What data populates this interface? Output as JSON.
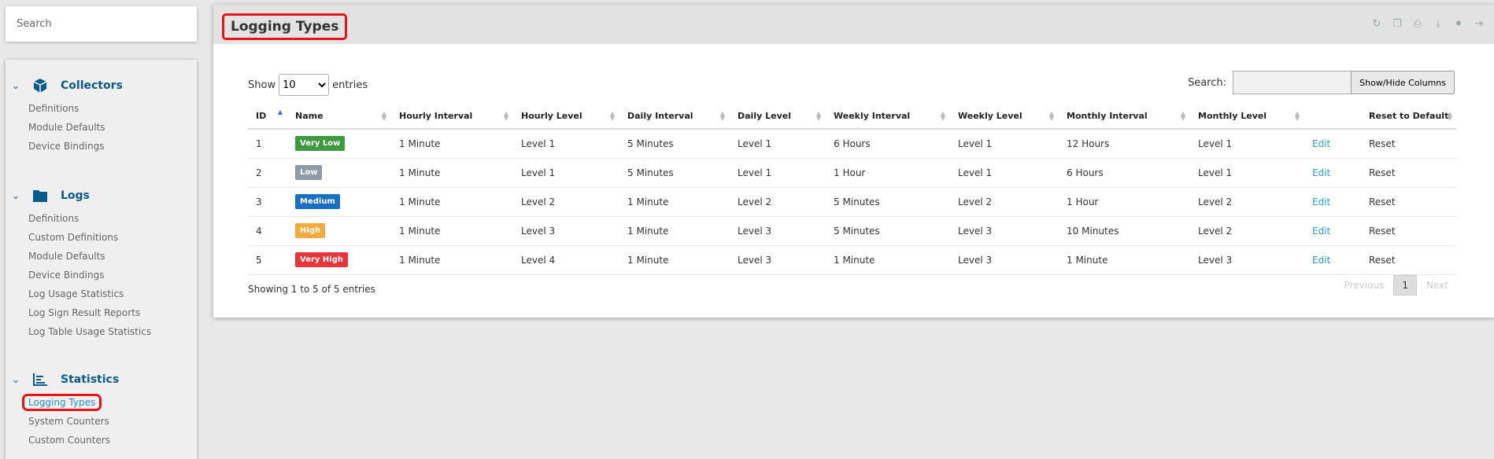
{
  "sidebar": {
    "search_placeholder": "Search",
    "sections": [
      {
        "title": "Collectors",
        "icon": "cube-icon",
        "items": [
          "Definitions",
          "Module Defaults",
          "Device Bindings"
        ]
      },
      {
        "title": "Logs",
        "icon": "folder-icon",
        "items": [
          "Definitions",
          "Custom Definitions",
          "Module Defaults",
          "Device Bindings",
          "Log Usage Statistics",
          "Log Sign Result Reports",
          "Log Table Usage Statistics"
        ]
      },
      {
        "title": "Statistics",
        "icon": "chart-icon",
        "items": [
          "Logging Types",
          "System Counters",
          "Custom Counters"
        ]
      }
    ],
    "active_item": "Logging Types"
  },
  "panel": {
    "title": "Logging Types",
    "show_label": "Show",
    "entries_label": "entries",
    "page_length": "10",
    "search_label": "Search:",
    "showhide_label": "Show/Hide Columns",
    "columns": [
      "ID",
      "Name",
      "Hourly Interval",
      "Hourly Level",
      "Daily Interval",
      "Daily Level",
      "Weekly Interval",
      "Weekly Level",
      "Monthly Interval",
      "Monthly Level",
      "",
      "Reset to Default"
    ],
    "rows": [
      {
        "id": "1",
        "name": "Very Low",
        "color": "#3f9a3f",
        "hi": "1 Minute",
        "hl": "Level 1",
        "di": "5 Minutes",
        "dl": "Level 1",
        "wi": "6 Hours",
        "wl": "Level 1",
        "mi": "12 Hours",
        "ml": "Level 1",
        "edit": "Edit",
        "reset": "Reset"
      },
      {
        "id": "2",
        "name": "Low",
        "color": "#8e9aa6",
        "hi": "1 Minute",
        "hl": "Level 1",
        "di": "5 Minutes",
        "dl": "Level 1",
        "wi": "1 Hour",
        "wl": "Level 1",
        "mi": "6 Hours",
        "ml": "Level 1",
        "edit": "Edit",
        "reset": "Reset"
      },
      {
        "id": "3",
        "name": "Medium",
        "color": "#1a6fc4",
        "hi": "1 Minute",
        "hl": "Level 2",
        "di": "1 Minute",
        "dl": "Level 2",
        "wi": "5 Minutes",
        "wl": "Level 2",
        "mi": "1 Hour",
        "ml": "Level 2",
        "edit": "Edit",
        "reset": "Reset"
      },
      {
        "id": "4",
        "name": "High",
        "color": "#f4a93c",
        "hi": "1 Minute",
        "hl": "Level 3",
        "di": "1 Minute",
        "dl": "Level 3",
        "wi": "5 Minutes",
        "wl": "Level 3",
        "mi": "10 Minutes",
        "ml": "Level 2",
        "edit": "Edit",
        "reset": "Reset"
      },
      {
        "id": "5",
        "name": "Very High",
        "color": "#e8353a",
        "hi": "1 Minute",
        "hl": "Level 4",
        "di": "1 Minute",
        "dl": "Level 3",
        "wi": "1 Minute",
        "wl": "Level 3",
        "mi": "1 Minute",
        "ml": "Level 3",
        "edit": "Edit",
        "reset": "Reset"
      }
    ],
    "info": "Showing 1 to 5 of 5 entries",
    "pager": {
      "previous": "Previous",
      "current": "1",
      "next": "Next"
    },
    "tool_icons": [
      "refresh-icon",
      "copy-icon",
      "print-icon",
      "download-icon",
      "toggle-icon",
      "pin-icon"
    ]
  }
}
